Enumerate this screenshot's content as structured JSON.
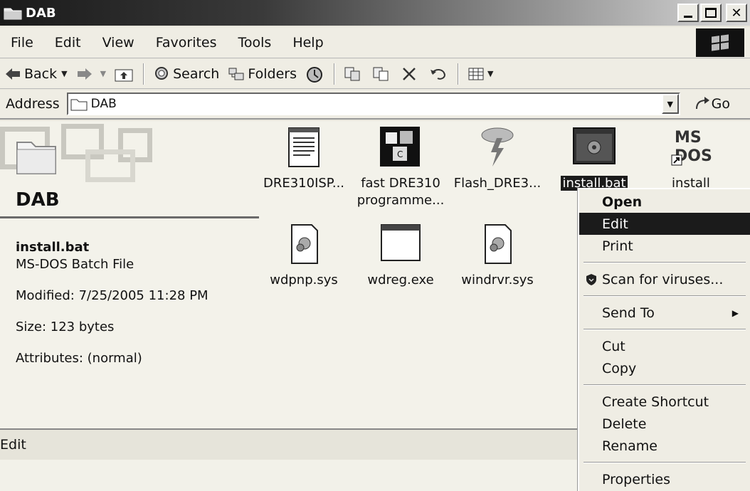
{
  "window": {
    "title": "DAB"
  },
  "menubar": {
    "items": [
      "File",
      "Edit",
      "View",
      "Favorites",
      "Tools",
      "Help"
    ]
  },
  "toolbar": {
    "back": "Back",
    "search": "Search",
    "folders": "Folders"
  },
  "address": {
    "label": "Address",
    "value": "DAB",
    "go": "Go"
  },
  "leftpane": {
    "title": "DAB",
    "file_name": "install.bat",
    "file_type": "MS-DOS Batch File",
    "modified": "Modified: 7/25/2005 11:28 PM",
    "size": "Size: 123 bytes",
    "attributes": "Attributes: (normal)"
  },
  "files": [
    {
      "label": "DRE310ISP...",
      "icon": "notepad-document-icon"
    },
    {
      "label": "fast DRE310 programme...",
      "icon": "application-blocks-icon"
    },
    {
      "label": "Flash_DRE3...",
      "icon": "flash-lightning-icon"
    },
    {
      "label": "install.bat",
      "icon": "batch-file-icon",
      "selected": true
    },
    {
      "label": "install",
      "icon": "ms-dos-shortcut-icon"
    },
    {
      "label": "wdpnp.sys",
      "icon": "system-file-icon"
    },
    {
      "label": "wdreg.exe",
      "icon": "exe-window-icon"
    },
    {
      "label": "windrvr.sys",
      "icon": "system-file-icon"
    }
  ],
  "context_menu": {
    "open": "Open",
    "edit": "Edit",
    "print": "Print",
    "scan": "Scan for viruses...",
    "send_to": "Send To",
    "cut": "Cut",
    "copy": "Copy",
    "create_shortcut": "Create Shortcut",
    "delete": "Delete",
    "rename": "Rename",
    "properties": "Properties"
  },
  "statusbar": {
    "text": "Edit"
  }
}
